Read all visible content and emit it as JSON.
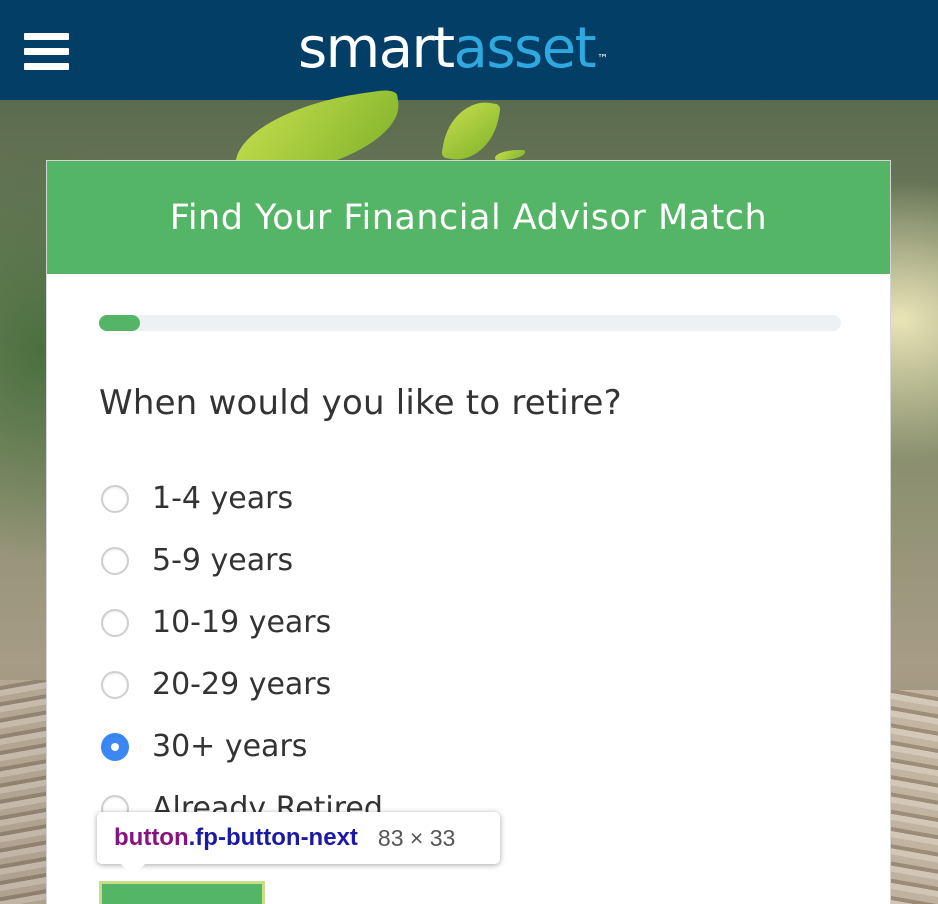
{
  "header": {
    "logo_part1": "smart",
    "logo_part2": "asset",
    "logo_tm": "™",
    "menu_icon": "hamburger-menu-icon",
    "colors": {
      "bar": "#033e66",
      "logo_accent": "#2ea9e0"
    }
  },
  "card": {
    "title": "Find Your Financial Advisor Match",
    "progress_fraction": 0.055,
    "question": "When would you like to retire?",
    "options": [
      {
        "label": "1-4 years",
        "checked": false
      },
      {
        "label": "5-9 years",
        "checked": false
      },
      {
        "label": "10-19 years",
        "checked": false
      },
      {
        "label": "20-29 years",
        "checked": false
      },
      {
        "label": "30+ years",
        "checked": true
      },
      {
        "label": "Already Retired",
        "checked": false
      }
    ],
    "colors": {
      "accent": "#55b566",
      "radio_selected": "#3b87f3"
    }
  },
  "devtools_tooltip": {
    "tag": "button",
    "class": ".fp-button-next",
    "size": "83 × 33"
  }
}
